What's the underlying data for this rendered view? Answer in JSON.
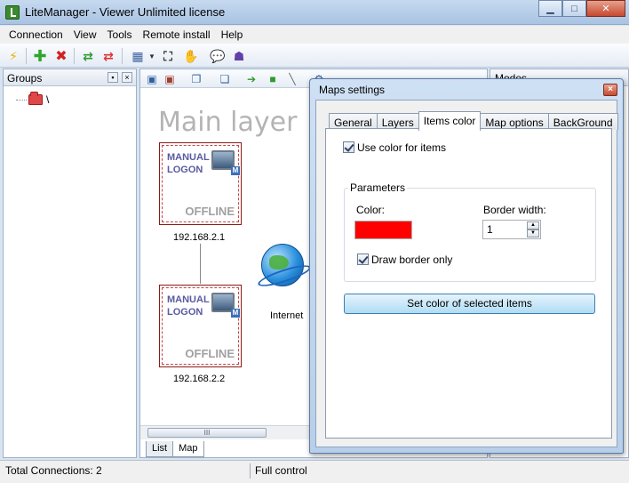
{
  "window": {
    "title": "LiteManager - Viewer   Unlimited license",
    "minimize_glyph": "▁",
    "maximize_glyph": "□",
    "close_glyph": "✕"
  },
  "menu": [
    "Connection",
    "View",
    "Tools",
    "Remote install",
    "Help"
  ],
  "groups_panel": {
    "title": "Groups",
    "pin_glyph": "▪",
    "close_glyph": "×",
    "root_label": "\\"
  },
  "modes_panel": {
    "title": "Modes"
  },
  "map": {
    "layer_title": "Main layer",
    "computers": [
      {
        "line1": "MANUAL",
        "line2": "LOGON",
        "status": "OFFLINE",
        "ip": "192.168.2.1"
      },
      {
        "line1": "MANUAL",
        "line2": "LOGON",
        "status": "OFFLINE",
        "ip": "192.168.2.2"
      }
    ],
    "internet_label": "Internet",
    "scroll_grip": "III",
    "tabs": [
      "List",
      "Map"
    ],
    "active_tab": "Map"
  },
  "statusbar": {
    "connections": "Total Connections:  2",
    "mode": "Full control"
  },
  "dialog": {
    "title": "Maps settings",
    "close_glyph": "×",
    "tabs": [
      "General",
      "Layers",
      "Items color",
      "Map options",
      "BackGround"
    ],
    "active_tab": "Items color",
    "use_color_label": "Use color for items",
    "use_color_checked": true,
    "parameters_caption": "Parameters",
    "color_label": "Color:",
    "color_value": "#ff0000",
    "border_width_label": "Border width:",
    "border_width_value": "1",
    "draw_border_label": "Draw border only",
    "draw_border_checked": true,
    "apply_button": "Set color of selected items"
  },
  "icons": {
    "toolbar": [
      "lightning-icon",
      "add-icon",
      "delete-icon",
      "refresh-green-icon",
      "refresh-red-icon",
      "view-icon",
      "chevron-down-icon",
      "binoculars-icon",
      "hand-icon",
      "chat-icon",
      "user-icon"
    ],
    "map_toolbar": [
      "add-item-icon",
      "remove-item-icon",
      "copy-icon",
      "paste-icon",
      "arrow-right-icon",
      "rectangle-icon",
      "line-icon",
      "settings-icon"
    ]
  }
}
